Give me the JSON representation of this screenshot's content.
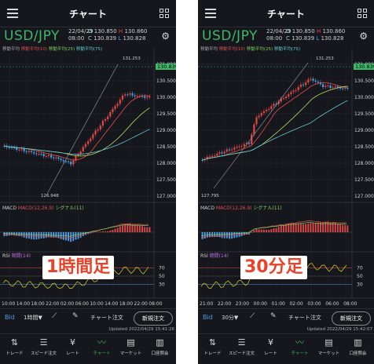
{
  "screens": [
    {
      "id": "left",
      "header": {
        "title": "チャート"
      },
      "pair": "USD/JPY",
      "date": "22/04/29",
      "time": "08:00",
      "open_label": "O",
      "open": "130.850",
      "high_label": "H",
      "high": "130.860",
      "close_label": "C",
      "close": "130.839",
      "low_label": "L",
      "low": "130.828",
      "legend": {
        "title": "移動平均",
        "ma1": "移動平均(10)",
        "ma2": "移動平均(25)",
        "ma3": "移動平均(75)"
      },
      "price_axis": [
        "131.000",
        "130.500",
        "130.000",
        "129.500",
        "129.000",
        "128.500",
        "128.000",
        "127.500",
        "127.000"
      ],
      "current_price": "130.839",
      "high_mark": "131.253",
      "low_mark": "126.948",
      "macd_label": {
        "name": "MACD",
        "params": "MACD(12,26,9)",
        "signal": "シグナル(11)"
      },
      "rsi_label": {
        "name": "RSI",
        "params": "期間(14)"
      },
      "rsi_axis": [
        "70",
        "50",
        "30"
      ],
      "time_axis": [
        "10:00",
        "14:00",
        "18:00",
        "22:00",
        "02:00",
        "06:00",
        "10:00",
        "14:00",
        "18:00",
        "22:00",
        "08:00"
      ],
      "badge": "1時間足",
      "toolbar": {
        "bid": "Bid",
        "timeframe": "1時間▼",
        "order": "チャート注文",
        "new_order": "新規注文"
      },
      "updated": "Updated 2022/04/29 15:41:26",
      "tabs": [
        "トレード",
        "スピード注文",
        "レート",
        "チャート",
        "マーケット",
        "口座照会"
      ]
    },
    {
      "id": "right",
      "header": {
        "title": "チャート"
      },
      "pair": "USD/JPY",
      "date": "22/04/29",
      "time": "08:00",
      "open_label": "O",
      "open": "130.850",
      "high_label": "H",
      "high": "130.860",
      "close_label": "C",
      "close": "130.839",
      "low_label": "L",
      "low": "130.828",
      "legend": {
        "title": "移動平均",
        "ma1": "移動平均(10)",
        "ma2": "移動平均(25)",
        "ma3": "移動平均(75)"
      },
      "price_axis": [
        "131.000",
        "130.500",
        "130.000",
        "129.500",
        "129.000",
        "128.500",
        "128.000",
        "127.500",
        "127.000"
      ],
      "current_price": "130.839",
      "high_mark": "131.253",
      "low_mark": "127.795",
      "macd_label": {
        "name": "MACD",
        "params": "MACD(12,26,9)",
        "signal": "シグナル(11)"
      },
      "rsi_label": {
        "name": "RSI",
        "params": "期間(14)"
      },
      "rsi_axis": [
        "70",
        "50",
        "30"
      ],
      "time_axis": [
        "21:00",
        "22:00",
        "23:00",
        "00:00",
        "01:00",
        "02:00",
        "03:00",
        "06:00",
        "08:00"
      ],
      "badge": "30分足",
      "toolbar": {
        "bid": "Bid",
        "timeframe": "30分▼",
        "order": "チャート注文",
        "new_order": "新規注文"
      },
      "updated": "Updated 2022/04/29 15:42:07",
      "tabs": [
        "トレード",
        "スピード注文",
        "レート",
        "チャート",
        "マーケット",
        "口座照会"
      ]
    }
  ],
  "colors": {
    "bg": "#15171c",
    "accent": "#3eb86a",
    "up": "#e04848",
    "down": "#4a9de8",
    "badge_text": "#e8432a"
  },
  "icons": [
    "menu-icon",
    "grid-icon",
    "gear-icon",
    "draw-tool-icon",
    "pen-icon",
    "trade-icon",
    "speed-order-icon",
    "rate-icon",
    "chart-icon",
    "market-icon",
    "account-icon"
  ]
}
